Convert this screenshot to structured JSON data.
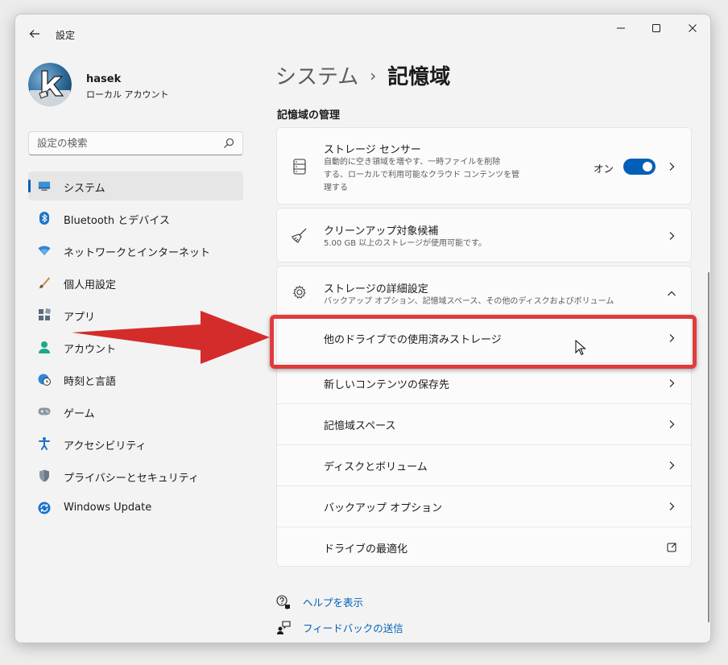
{
  "window": {
    "title": "設定"
  },
  "user": {
    "name": "hasek",
    "account_type": "ローカル アカウント"
  },
  "search": {
    "placeholder": "設定の検索"
  },
  "nav": {
    "items": [
      {
        "label": "システム",
        "icon": "system-icon",
        "selected": true
      },
      {
        "label": "Bluetooth とデバイス",
        "icon": "bluetooth-icon"
      },
      {
        "label": "ネットワークとインターネット",
        "icon": "wifi-icon"
      },
      {
        "label": "個人用設定",
        "icon": "brush-icon"
      },
      {
        "label": "アプリ",
        "icon": "apps-icon"
      },
      {
        "label": "アカウント",
        "icon": "account-icon"
      },
      {
        "label": "時刻と言語",
        "icon": "globe-clock-icon"
      },
      {
        "label": "ゲーム",
        "icon": "gamepad-icon"
      },
      {
        "label": "アクセシビリティ",
        "icon": "accessibility-icon"
      },
      {
        "label": "プライバシーとセキュリティ",
        "icon": "shield-icon"
      },
      {
        "label": "Windows Update",
        "icon": "windows-update-icon"
      }
    ]
  },
  "main": {
    "breadcrumb": {
      "parent": "システム",
      "separator": "›",
      "current": "記憶域"
    },
    "section_title": "記憶域の管理",
    "storage_sense": {
      "title": "ストレージ センサー",
      "desc_line1": "自動的に空き領域を増やす、一時ファイルを削除",
      "desc_line2": "する、ローカルで利用可能なクラウド コンテンツを管",
      "desc_line3": "理する",
      "toggle_label": "オン",
      "toggle_on": true
    },
    "cleanup": {
      "title": "クリーンアップ対象候補",
      "desc": "5.00 GB 以上のストレージが使用可能です。"
    },
    "advanced": {
      "title": "ストレージの詳細設定",
      "desc": "バックアップ オプション、記憶域スペース、その他のディスクおよびボリューム",
      "items": [
        "他のドライブでの使用済みストレージ",
        "新しいコンテンツの保存先",
        "記憶域スペース",
        "ディスクとボリューム",
        "バックアップ オプション",
        "ドライブの最適化"
      ]
    }
  },
  "help": {
    "get_help": "ヘルプを表示",
    "feedback": "フィードバックの送信"
  },
  "colors": {
    "accent": "#005fb8",
    "highlight": "#e23b3b",
    "arrow": "#d42b2b"
  }
}
